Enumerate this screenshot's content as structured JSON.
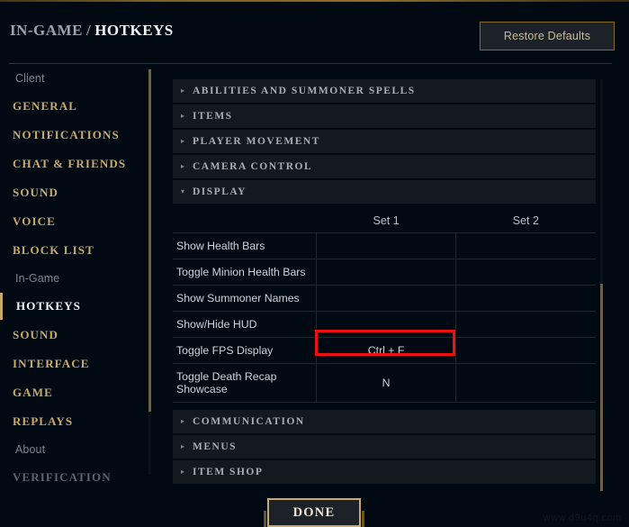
{
  "header": {
    "breadcrumb_parent": "IN-GAME",
    "breadcrumb_separator": "/",
    "breadcrumb_current": "HOTKEYS",
    "restore_label": "Restore Defaults"
  },
  "sidebar": {
    "groups": [
      {
        "label": "Client",
        "items": [
          {
            "label": "GENERAL",
            "state": "normal"
          },
          {
            "label": "NOTIFICATIONS",
            "state": "normal"
          },
          {
            "label": "CHAT & FRIENDS",
            "state": "normal"
          },
          {
            "label": "SOUND",
            "state": "normal"
          },
          {
            "label": "VOICE",
            "state": "normal"
          },
          {
            "label": "BLOCK LIST",
            "state": "normal"
          }
        ]
      },
      {
        "label": "In-Game",
        "items": [
          {
            "label": "HOTKEYS",
            "state": "active"
          },
          {
            "label": "SOUND",
            "state": "normal"
          },
          {
            "label": "INTERFACE",
            "state": "normal"
          },
          {
            "label": "GAME",
            "state": "normal"
          },
          {
            "label": "REPLAYS",
            "state": "normal"
          }
        ]
      },
      {
        "label": "About",
        "items": [
          {
            "label": "VERIFICATION",
            "state": "dim"
          }
        ]
      }
    ]
  },
  "content": {
    "sections_above": [
      {
        "title": "ABILITIES AND SUMMONER SPELLS",
        "expanded": false,
        "caret": "▸"
      },
      {
        "title": "ITEMS",
        "expanded": false,
        "caret": "▸"
      },
      {
        "title": "PLAYER MOVEMENT",
        "expanded": false,
        "caret": "▸"
      },
      {
        "title": "CAMERA CONTROL",
        "expanded": false,
        "caret": "▸"
      },
      {
        "title": "DISPLAY",
        "expanded": true,
        "caret": "▾"
      }
    ],
    "sections_below": [
      {
        "title": "COMMUNICATION",
        "expanded": false,
        "caret": "▸"
      },
      {
        "title": "MENUS",
        "expanded": false,
        "caret": "▸"
      },
      {
        "title": "ITEM SHOP",
        "expanded": false,
        "caret": "▸"
      }
    ],
    "table": {
      "columns": [
        "",
        "Set 1",
        "Set 2"
      ],
      "rows": [
        {
          "name": "Show Health Bars",
          "set1": "",
          "set2": ""
        },
        {
          "name": "Toggle Minion Health Bars",
          "set1": "",
          "set2": ""
        },
        {
          "name": "Show Summoner Names",
          "set1": "",
          "set2": ""
        },
        {
          "name": "Show/Hide HUD",
          "set1": "",
          "set2": ""
        },
        {
          "name": "Toggle FPS Display",
          "set1": "Ctrl + F",
          "set2": "",
          "highlighted": true
        },
        {
          "name": "Toggle Death Recap Showcase",
          "set1": "N",
          "set2": ""
        }
      ]
    }
  },
  "footer": {
    "done_label": "DONE"
  },
  "watermark": {
    "text": "www.d9u4q.com"
  },
  "colors": {
    "background": "#010a13",
    "gold": "#c8aa6e",
    "gold_dark": "#7a6028",
    "section_row": "#12191f",
    "text_primary": "#cfd5da",
    "text_muted": "#7d868f",
    "highlight_red": "#ee1111"
  }
}
